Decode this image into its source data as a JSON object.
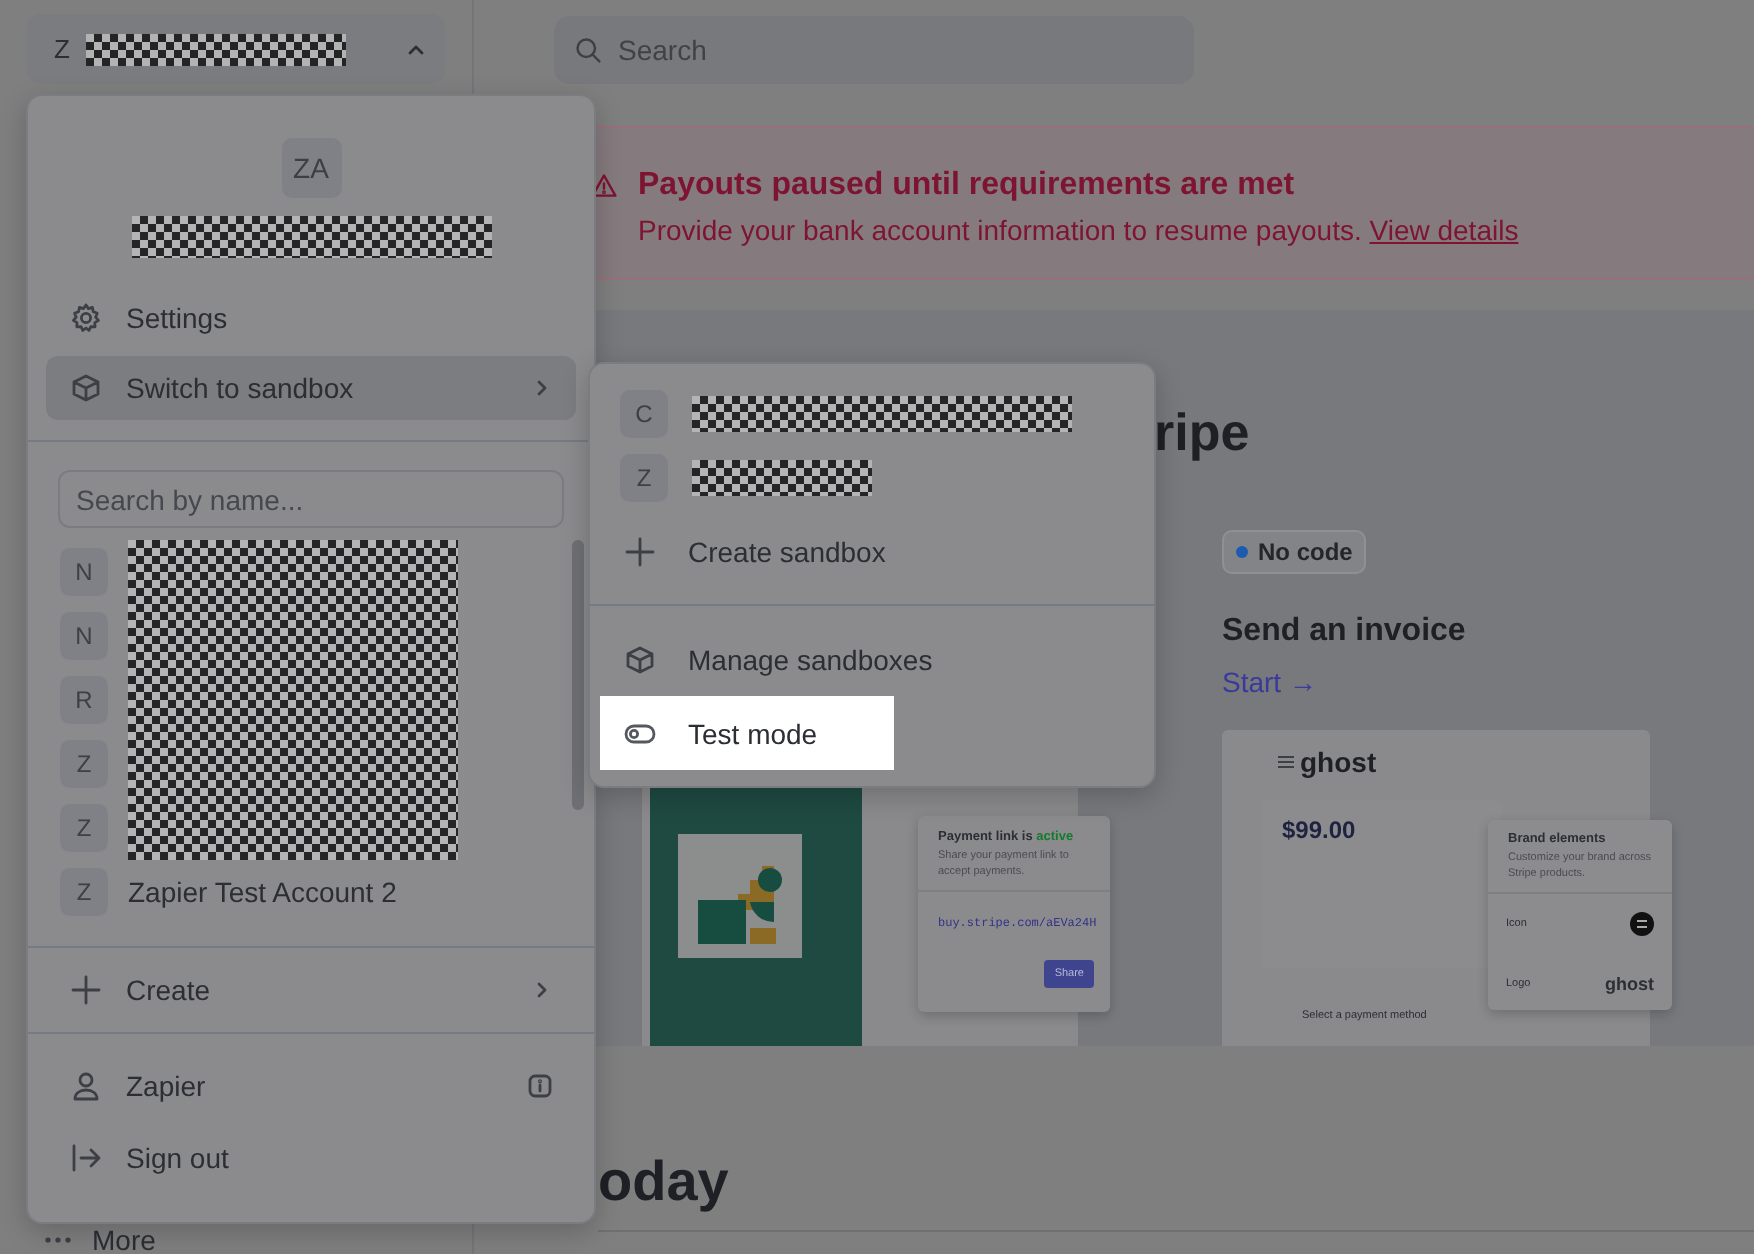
{
  "sidebar": {
    "account_switcher": {
      "initial": "Z"
    },
    "more_label": "More"
  },
  "search": {
    "placeholder": "Search"
  },
  "banner": {
    "title": "Payouts paused until requirements are met",
    "message": "Provide your bank account information to resume payouts.",
    "link": "View details"
  },
  "get_started": {
    "heading": "ripe",
    "feature": {
      "badge": "No code",
      "title": "Send an invoice",
      "link": "Start →"
    },
    "payment_link_preview": {
      "title": "Payment link is",
      "status": "active",
      "description": "Share your payment link to accept payments.",
      "url": "buy.stripe.com/aEVa24H",
      "button": "Share"
    },
    "invoice_preview": {
      "logo": "ghost",
      "amount": "$99.00",
      "footer": "Select a payment method",
      "brand_card": {
        "title": "Brand elements",
        "description": "Customize your brand across Stripe products.",
        "rows": [
          {
            "kind": "icon",
            "label": "Icon"
          },
          {
            "kind": "logo",
            "label": "Logo",
            "logo": "ghost"
          }
        ]
      }
    }
  },
  "today_heading": "oday",
  "account_menu": {
    "avatar": "ZA",
    "items": [
      {
        "label": "Settings",
        "kind": "gear",
        "submenu": false,
        "highlighted": false
      },
      {
        "label": "Switch to sandbox",
        "kind": "cube",
        "submenu": true,
        "highlighted": true
      }
    ],
    "search_placeholder": "Search by name...",
    "accounts": [
      {
        "initial": "N"
      },
      {
        "initial": "N"
      },
      {
        "initial": "R"
      },
      {
        "initial": "Z"
      },
      {
        "initial": "Z"
      },
      {
        "initial": "Z",
        "name": "Zapier Test Account 2"
      }
    ],
    "actions": [
      {
        "label": "Create",
        "kind": "plus",
        "submenu": true
      }
    ],
    "footer": [
      {
        "label": "Zapier",
        "kind": "person",
        "info": true
      },
      {
        "label": "Sign out",
        "kind": "signout",
        "info": false
      }
    ]
  },
  "sandbox_menu": {
    "sandboxes": [
      {
        "initial": "C"
      },
      {
        "initial": "Z"
      }
    ],
    "sections": [
      {
        "items": [
          {
            "label": "Create sandbox",
            "kind": "plus",
            "highlighted": false
          }
        ]
      },
      {
        "items": [
          {
            "label": "Manage sandboxes",
            "kind": "cube",
            "highlighted": false
          },
          {
            "label": "Test mode",
            "kind": "toggle",
            "highlighted": true
          }
        ]
      }
    ]
  }
}
